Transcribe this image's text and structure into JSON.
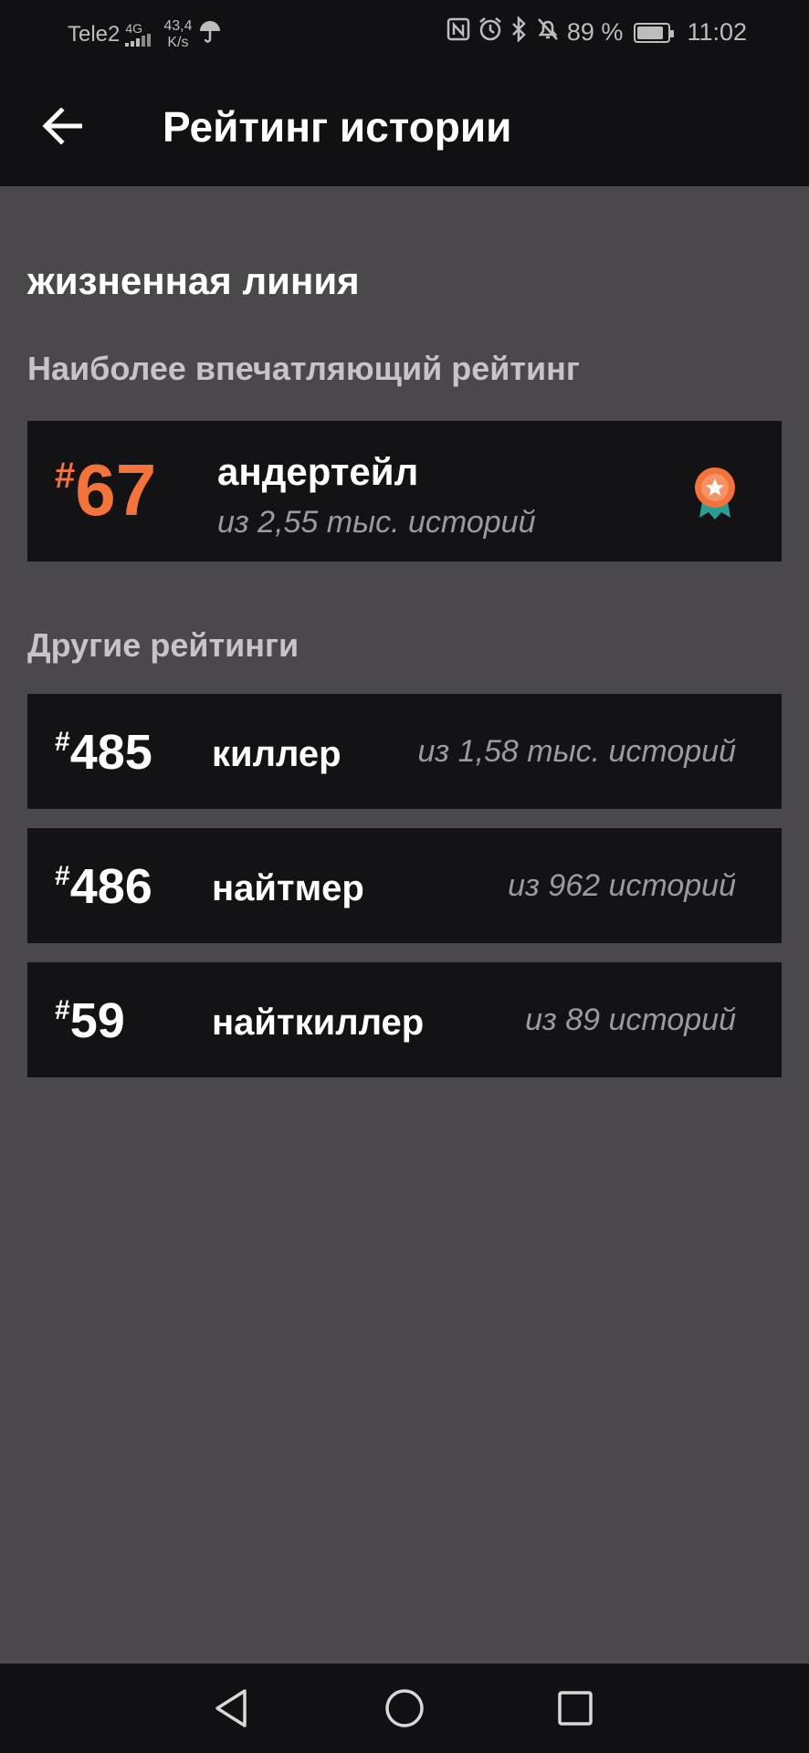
{
  "status_bar": {
    "carrier": "Tele2",
    "network": "4G",
    "speed_value": "43,4",
    "speed_unit": "K/s",
    "battery": "89 %",
    "battery_level": 0.89,
    "time": "11:02"
  },
  "app_bar": {
    "title": "Рейтинг истории"
  },
  "story": {
    "name": "жизненная линия"
  },
  "best": {
    "section_title": "Наиболее впечатляющий рейтинг",
    "hash": "#",
    "rank": "67",
    "tag": "андертейл",
    "of_text": "из 2,55 тыс. историй",
    "accent_color": "#f4733a"
  },
  "others": {
    "section_title": "Другие рейтинги",
    "items": [
      {
        "hash": "#",
        "rank": "485",
        "tag": "киллер",
        "of_text": "из 1,58 тыс. историй"
      },
      {
        "hash": "#",
        "rank": "486",
        "tag": "найтмер",
        "of_text": "из 962 историй"
      },
      {
        "hash": "#",
        "rank": "59",
        "tag": "найткиллер",
        "of_text": "из 89 историй"
      }
    ]
  }
}
